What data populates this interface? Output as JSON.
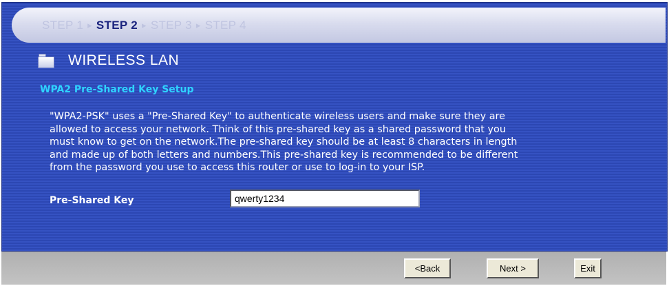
{
  "steps": {
    "step1": "STEP 1",
    "step2": "STEP 2",
    "step3": "STEP 3",
    "step4": "STEP 4",
    "sep": "▸"
  },
  "section": {
    "icon": "folder-icon",
    "title": "WIRELESS LAN"
  },
  "subtitle": "WPA2 Pre-Shared Key Setup",
  "description": {
    "lines": [
      "\"WPA2-PSK\" uses a \"Pre-Shared Key\" to authenticate wireless users and make sure they are",
      "allowed to access your network. Think of this pre-shared key as a shared password that you",
      "must know to get on the network.The pre-shared key should be at least 8 characters in length",
      "and made up of both letters and numbers.This pre-shared key is recommended to be different",
      "from the password you use to access this router or use to log-in to your ISP."
    ]
  },
  "form": {
    "psk_label": "Pre-Shared Key",
    "psk_value": "qwerty1234"
  },
  "buttons": {
    "back": "<Back",
    "next": "Next >",
    "exit": "Exit"
  },
  "colors": {
    "panel_blue": "#2c47b3",
    "subtitle_cyan": "#2ed3ff",
    "step_active": "#1a237e",
    "step_inactive": "#bfc4e0",
    "bottom_gray": "#b8b8b8"
  }
}
